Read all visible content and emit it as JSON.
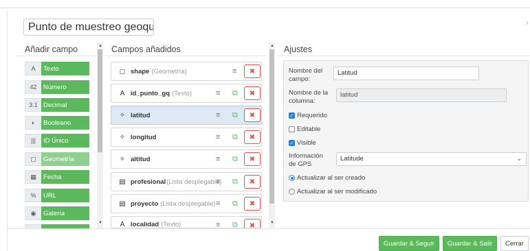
{
  "dialog": {
    "title_value": "Punto de muestreo geoqu"
  },
  "left": {
    "title": "Añadir campo",
    "field_types": [
      {
        "icon": "A",
        "icon_name": "text-icon",
        "label": "Texto"
      },
      {
        "icon": "42",
        "icon_name": "number-icon",
        "label": "Número"
      },
      {
        "icon": "3.1",
        "icon_name": "decimal-icon",
        "label": "Decimal"
      },
      {
        "icon": "◐",
        "icon_name": "toggle-icon",
        "label": "Booleano"
      },
      {
        "icon": "|||",
        "icon_name": "barcode-icon",
        "label": "ID Único"
      },
      {
        "icon": "▢",
        "icon_name": "geometry-icon",
        "label": "Geometría"
      },
      {
        "icon": "▦",
        "icon_name": "calendar-icon",
        "label": "Fecha"
      },
      {
        "icon": "%",
        "icon_name": "link-icon",
        "label": "URL"
      },
      {
        "icon": "◉",
        "icon_name": "camera-icon",
        "label": "Galería"
      }
    ]
  },
  "middle": {
    "title": "Campos añadidos",
    "fields": [
      {
        "icon": "▢",
        "icon_name": "geometry-icon",
        "name": "shape",
        "type": "(Geometría)"
      },
      {
        "icon": "A",
        "icon_name": "text-icon",
        "name": "id_punto_gq",
        "type": "(Texto)"
      },
      {
        "icon": "✧",
        "icon_name": "gps-icon",
        "name": "latitud",
        "type": ""
      },
      {
        "icon": "✧",
        "icon_name": "gps-icon",
        "name": "longitud",
        "type": ""
      },
      {
        "icon": "✧",
        "icon_name": "gps-icon",
        "name": "altitud",
        "type": ""
      },
      {
        "icon": "▤",
        "icon_name": "list-icon",
        "name": "profesional",
        "type": "(Lista desplegable)"
      },
      {
        "icon": "▤",
        "icon_name": "list-icon",
        "name": "proyecto",
        "type": "(Lista desplegable)"
      },
      {
        "icon": "A",
        "icon_name": "text-icon",
        "name": "localidad",
        "type": "(Texto)"
      }
    ],
    "menu_glyph": "≡",
    "copy_glyph": "⧉",
    "delete_glyph": "✖"
  },
  "settings": {
    "title": "Ajustes",
    "field_name_label_1": "Nombre del",
    "field_name_label_2": "campo:",
    "field_name_value": "Latitud",
    "column_name_label_1": "Nombre de la",
    "column_name_label_2": "columna:",
    "column_name_value": "latitud",
    "required_label": "Requerido",
    "editable_label": "Editable",
    "visible_label": "Visible",
    "gps_label_1": "Información",
    "gps_label_2": "de GPS",
    "gps_value": "Latitude",
    "update_created_label": "Actualizar al ser creado",
    "update_modified_label": "Actualizar al ser modificado"
  },
  "footer": {
    "save_continue": "Guardar & Seguir",
    "save_exit": "Guardar & Salir",
    "close": "Cerrar"
  },
  "colors": {
    "green": "#5cb85c",
    "danger": "#d9534f",
    "primary": "#2d7cd6",
    "selected_row": "#dde9f5"
  }
}
